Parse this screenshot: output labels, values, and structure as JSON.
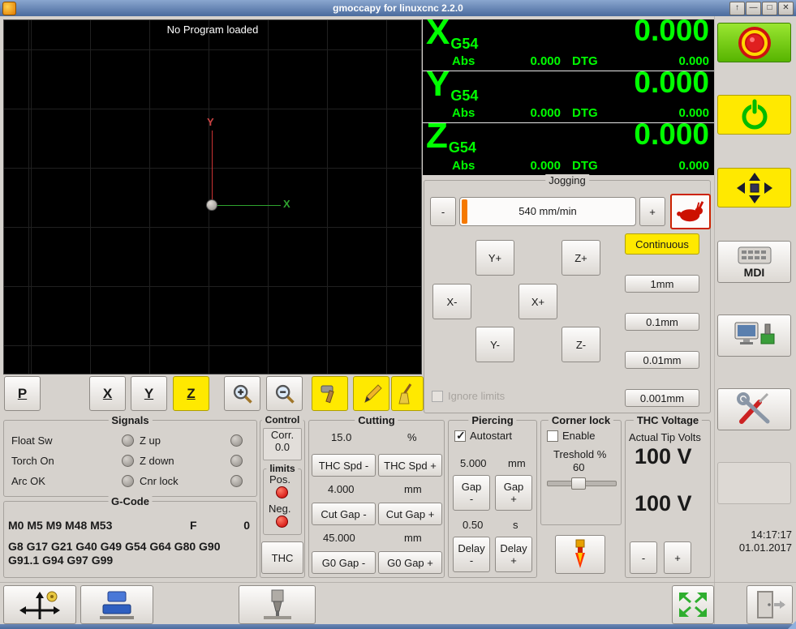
{
  "window": {
    "title": "gmoccapy for linuxcnc  2.2.0",
    "controls": {
      "shade": "↑",
      "minimize": "—",
      "maximize": "□",
      "close": "✕"
    }
  },
  "preview": {
    "message": "No Program loaded",
    "axis_x": "X",
    "axis_y": "Y",
    "toolbar": {
      "p": "P",
      "x": "X",
      "y": "Y",
      "z": "Z"
    }
  },
  "dro": [
    {
      "axis": "X",
      "system": "G54",
      "value": "0.000",
      "abs_label": "Abs",
      "abs_value": "0.000",
      "dtg_label": "DTG",
      "dtg_value": "0.000"
    },
    {
      "axis": "Y",
      "system": "G54",
      "value": "0.000",
      "abs_label": "Abs",
      "abs_value": "0.000",
      "dtg_label": "DTG",
      "dtg_value": "0.000"
    },
    {
      "axis": "Z",
      "system": "G54",
      "value": "0.000",
      "abs_label": "Abs",
      "abs_value": "0.000",
      "dtg_label": "DTG",
      "dtg_value": "0.000"
    }
  ],
  "jogging": {
    "title": "Jogging",
    "minus": "-",
    "plus": "+",
    "speed_display": "540 mm/min",
    "continuous": "Continuous",
    "jog_buttons": [
      "Y+",
      "Z+",
      "X-",
      "X+",
      "Y-",
      "Z-"
    ],
    "increments": [
      "1mm",
      "0.1mm",
      "0.01mm",
      "0.001mm"
    ],
    "ignore_limits": "Ignore limits",
    "ignore_limits_checked": false
  },
  "signals": {
    "title": "Signals",
    "left": [
      "Float Sw",
      "Torch On",
      "Arc OK"
    ],
    "right": [
      "Z up",
      "Z down",
      "Cnr lock"
    ]
  },
  "gcode": {
    "title": "G-Code",
    "m_codes": "M0 M5 M9 M48 M53",
    "f_label": "F",
    "f_value": "0",
    "g_codes": "G8 G17 G21 G40 G49 G54 G64 G80 G90 G91.1 G94 G97 G99"
  },
  "control": {
    "title": "Control",
    "corr_label": "Corr.",
    "corr_value": "0.0",
    "limits_title": "limits",
    "pos_label": "Pos.",
    "neg_label": "Neg.",
    "thc_button": "THC"
  },
  "cutting": {
    "title": "Cutting",
    "feed_value": "15.0",
    "feed_unit": "%",
    "thc_spd_minus": "THC Spd -",
    "thc_spd_plus": "THC Spd +",
    "cut_gap_value": "4.000",
    "cut_gap_unit": "mm",
    "cut_gap_minus": "Cut Gap -",
    "cut_gap_plus": "Cut Gap +",
    "g0_gap_value": "45.000",
    "g0_gap_unit": "mm",
    "g0_gap_minus": "G0 Gap -",
    "g0_gap_plus": "G0 Gap +"
  },
  "piercing": {
    "title": "Piercing",
    "autostart": "Autostart",
    "autostart_checked": true,
    "gap_value": "5.000",
    "gap_unit": "mm",
    "gap_label": "Gap",
    "minus": "-",
    "plus": "+",
    "delay_value": "0.50",
    "delay_unit": "s",
    "delay_label": "Delay"
  },
  "corner_lock": {
    "title": "Corner lock",
    "enable": "Enable",
    "enable_checked": false,
    "threshold_label": "Treshold %",
    "threshold_value": "60"
  },
  "thc_voltage": {
    "title": "THC Voltage",
    "subtitle": "Actual Tip Volts",
    "actual_volts": "100 V",
    "target_volts": "100 V",
    "minus": "-",
    "plus": "+"
  },
  "right_panel": {
    "mdi_label": "MDI",
    "time": "14:17:17",
    "date": "01.01.2017"
  }
}
